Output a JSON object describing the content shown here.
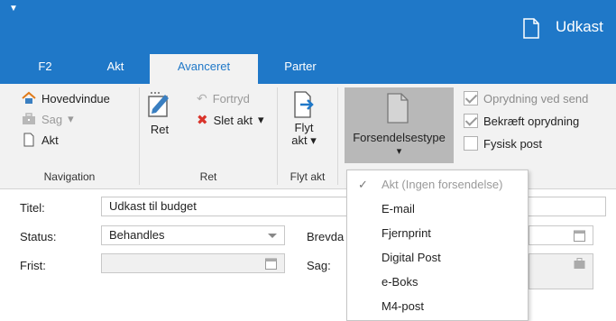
{
  "titlebar": {
    "title": "Udkast",
    "quick_access_glyph": "▼"
  },
  "tabs": [
    {
      "label": "F2",
      "active": false
    },
    {
      "label": "Akt",
      "active": false
    },
    {
      "label": "Avanceret",
      "active": true
    },
    {
      "label": "Parter",
      "active": false
    }
  ],
  "ribbon": {
    "navigation": {
      "items": [
        {
          "label": "Hovedvindue",
          "icon": "home-icon",
          "disabled": false
        },
        {
          "label": "Sag",
          "icon": "briefcase-icon",
          "disabled": true,
          "dropdown": "▾"
        },
        {
          "label": "Akt",
          "icon": "document-icon",
          "disabled": false
        }
      ],
      "group_label": "Navigation"
    },
    "ret": {
      "big_label": "Ret",
      "undo_label": "Fortryd",
      "delete_label": "Slet akt",
      "delete_dropdown": "▾",
      "group_label": "Ret"
    },
    "flyt": {
      "line1": "Flyt",
      "line2": "akt",
      "dropdown": "▾",
      "group_label": "Flyt akt"
    },
    "forsendelse": {
      "label": "Forsendelsestype",
      "dropdown": "▾"
    },
    "checks": [
      {
        "label": "Oprydning ved send",
        "checked": true,
        "disabled": true
      },
      {
        "label": "Bekræft oprydning",
        "checked": true,
        "disabled": false
      },
      {
        "label": "Fysisk post",
        "checked": false,
        "disabled": false
      }
    ]
  },
  "form": {
    "title_label": "Titel:",
    "title_value": "Udkast til budget",
    "status_label": "Status:",
    "status_value": "Behandles",
    "brevdato_label": "Brevda",
    "frist_label": "Frist:",
    "frist_value": "",
    "sag_label": "Sag:"
  },
  "menu": {
    "items": [
      {
        "label": "Akt (Ingen forsendelse)",
        "checked": true,
        "disabled": true
      },
      {
        "label": "E-mail",
        "checked": false,
        "disabled": false
      },
      {
        "label": "Fjernprint",
        "checked": false,
        "disabled": false
      },
      {
        "label": "Digital Post",
        "checked": false,
        "disabled": false
      },
      {
        "label": "e-Boks",
        "checked": false,
        "disabled": false
      },
      {
        "label": "M4-post",
        "checked": false,
        "disabled": false
      }
    ],
    "check_glyph": "✓"
  },
  "colors": {
    "accent": "#1f78c8",
    "ribbon_bg": "#f2f2f2",
    "pressed": "#b8b8b8",
    "delete_red": "#d9342b"
  }
}
